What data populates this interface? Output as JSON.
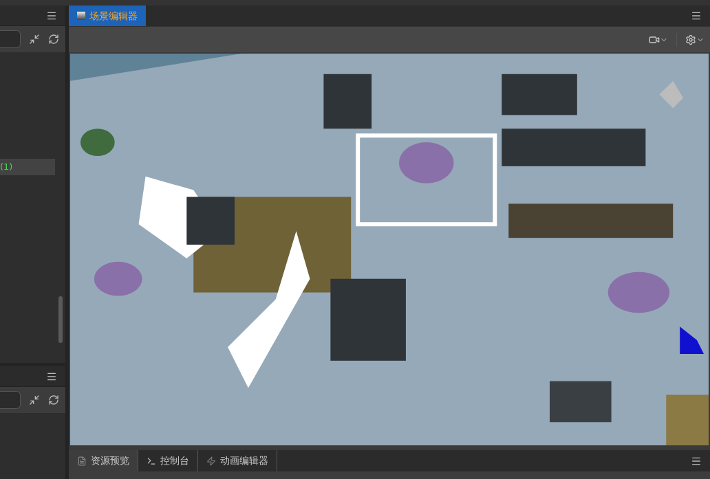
{
  "hierarchy_panel": {
    "rows": [
      {
        "label": "(1)",
        "selected": true
      }
    ]
  },
  "scene_editor": {
    "tabs": [
      {
        "label": "场景编辑器",
        "selected": true
      }
    ]
  },
  "bottom_tabs": [
    {
      "label": "资源预览",
      "kind": "preview",
      "selected": true
    },
    {
      "label": "控制台",
      "kind": "console",
      "selected": false
    },
    {
      "label": "动画编辑器",
      "kind": "animation",
      "selected": false
    }
  ]
}
